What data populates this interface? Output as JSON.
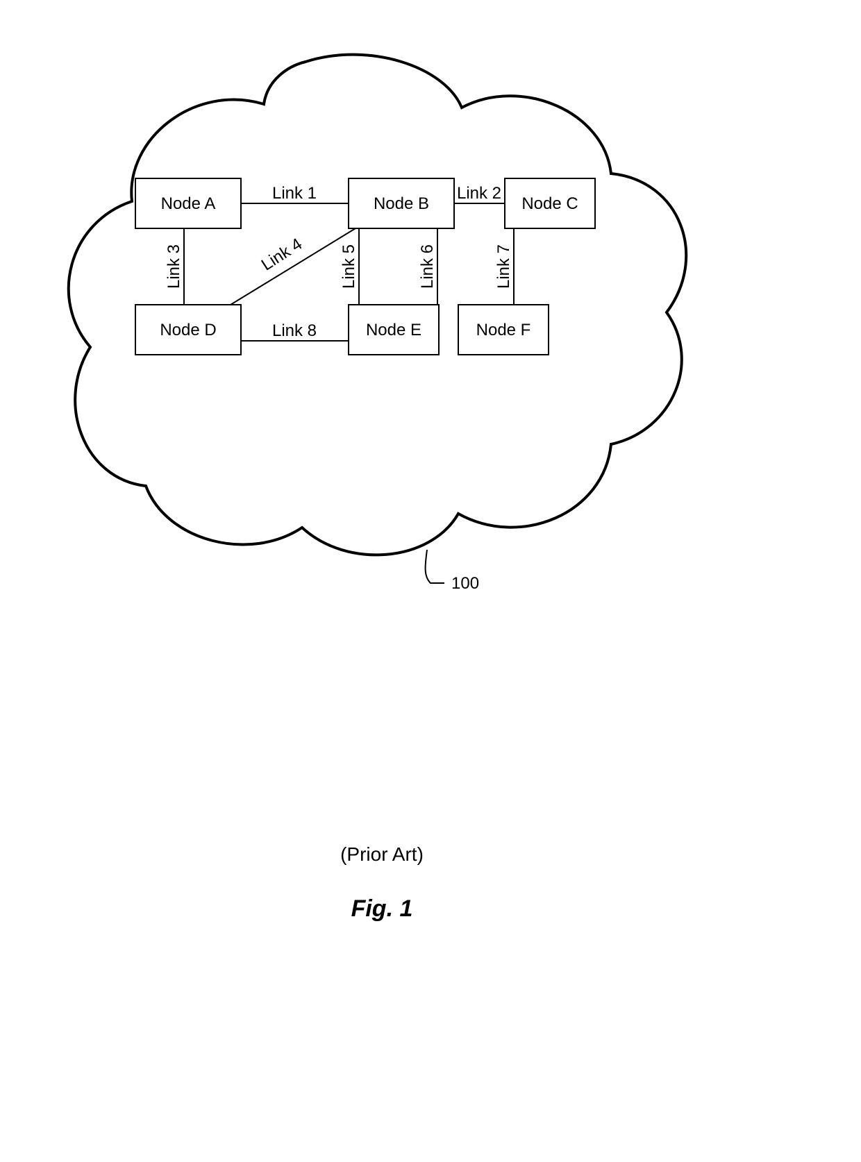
{
  "nodes": {
    "A": "Node A",
    "B": "Node B",
    "C": "Node C",
    "D": "Node D",
    "E": "Node E",
    "F": "Node F"
  },
  "links": {
    "1": "Link 1",
    "2": "Link 2",
    "3": "Link 3",
    "4": "Link 4",
    "5": "Link 5",
    "6": "Link 6",
    "7": "Link 7",
    "8": "Link 8"
  },
  "ref_number": "100",
  "prior_art": "(Prior Art)",
  "figure_caption": "Fig. 1"
}
